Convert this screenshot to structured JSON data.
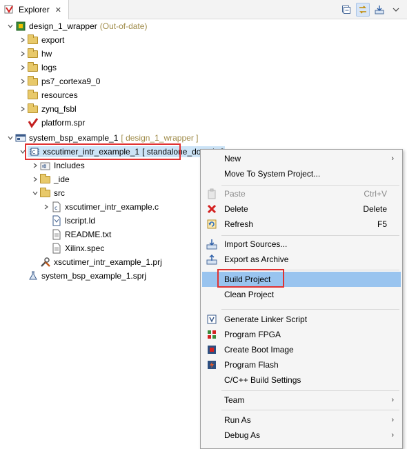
{
  "tab": {
    "label": "Explorer",
    "close": "✕"
  },
  "toolbar": {
    "buttons": [
      "collapse-all",
      "link-with-editor",
      "import",
      "view-menu"
    ]
  },
  "tree": {
    "platform": {
      "name": "design_1_wrapper",
      "status": "(Out-of-date)",
      "children": [
        "export",
        "hw",
        "logs",
        "ps7_cortexa9_0",
        "resources",
        "zynq_fsbl",
        "platform.spr"
      ]
    },
    "system": {
      "name": "system_bsp_example_1",
      "decoration": "[ design_1_wrapper ]",
      "app": {
        "name": "xscutimer_intr_example_1",
        "decoration": "[ standalone_domain ]",
        "children": [
          "Includes",
          "_ide",
          "src"
        ],
        "src_children": [
          "xscutimer_intr_example.c",
          "lscript.ld",
          "README.txt",
          "Xilinx.spec"
        ],
        "prj": "xscutimer_intr_example_1.prj"
      },
      "sprj": "system_bsp_example_1.sprj"
    }
  },
  "menu": {
    "new": "New",
    "move": "Move To System Project...",
    "paste": "Paste",
    "paste_acc": "Ctrl+V",
    "delete": "Delete",
    "delete_acc": "Delete",
    "refresh": "Refresh",
    "refresh_acc": "F5",
    "import": "Import Sources...",
    "export": "Export as Archive",
    "build": "Build Project",
    "clean": "Clean Project",
    "linker": "Generate Linker Script",
    "fpga": "Program FPGA",
    "boot": "Create Boot Image",
    "flash": "Program Flash",
    "cbuild": "C/C++ Build Settings",
    "team": "Team",
    "run": "Run As",
    "debug": "Debug As",
    "arrow": "›"
  },
  "colors": {
    "selection": "#cce4f7",
    "menu_hover": "#99c4ef",
    "highlight": "#e03131",
    "decoration": "#a08c4a"
  }
}
